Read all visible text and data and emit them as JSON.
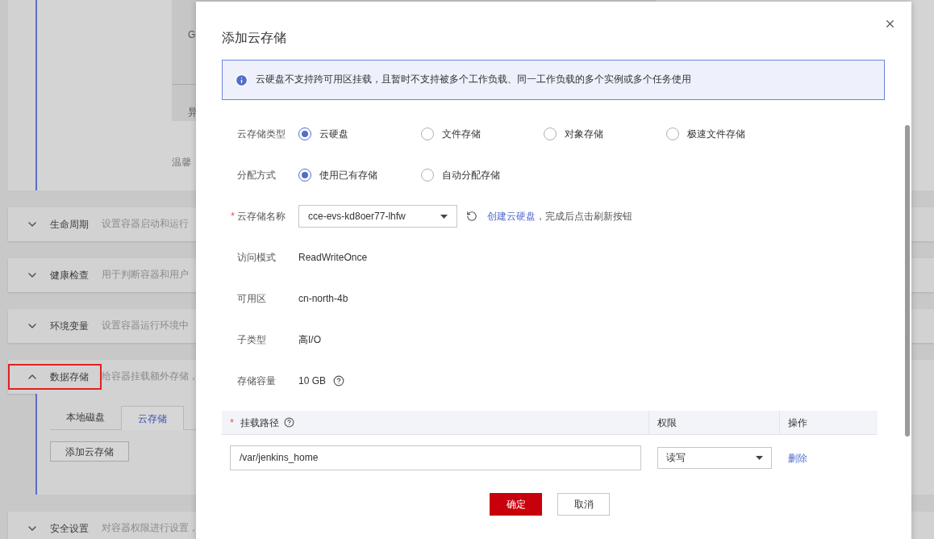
{
  "background": {
    "table_fragments": [
      "G",
      "异"
    ],
    "note": "温馨",
    "sections": [
      {
        "title": "生命周期",
        "description": "设置容器启动和运行",
        "expanded": false,
        "highlighted": false
      },
      {
        "title": "健康检查",
        "description": "用于判断容器和用户",
        "expanded": false,
        "highlighted": false
      },
      {
        "title": "环境变量",
        "description": "设置容器运行环境中",
        "expanded": false,
        "highlighted": false
      },
      {
        "title": "数据存储",
        "description": "给容器挂载额外存储，",
        "expanded": true,
        "highlighted": true,
        "tabs": [
          {
            "label": "本地磁盘",
            "selected": false
          },
          {
            "label": "云存储",
            "selected": true
          }
        ],
        "add_button": "添加云存储"
      },
      {
        "title": "安全设置",
        "description": "对容器权限进行设置，",
        "expanded": false,
        "highlighted": false
      }
    ]
  },
  "dialog": {
    "title": "添加云存储",
    "required_mark": "*",
    "notice": "云硬盘不支持跨可用区挂载，且暂时不支持被多个工作负载、同一工作负载的多个实例或多个任务使用",
    "fields": [
      {
        "kind": "radio",
        "label": "云存储类型",
        "required": false,
        "options": [
          {
            "label": "云硬盘",
            "selected": true
          },
          {
            "label": "文件存储",
            "selected": false
          },
          {
            "label": "对象存储",
            "selected": false
          },
          {
            "label": "极速文件存储",
            "selected": false
          }
        ]
      },
      {
        "kind": "radio",
        "label": "分配方式",
        "required": false,
        "options": [
          {
            "label": "使用已有存储",
            "selected": true
          },
          {
            "label": "自动分配存储",
            "selected": false
          }
        ]
      },
      {
        "kind": "select",
        "label": "云存储名称",
        "required": true,
        "value": "cce-evs-kd8oer77-lhfw",
        "link": "创建云硬盘",
        "hint": "，完成后点击刷新按钮"
      },
      {
        "kind": "text",
        "label": "访问模式",
        "required": false,
        "value": "ReadWriteOnce",
        "help": false
      },
      {
        "kind": "text",
        "label": "可用区",
        "required": false,
        "value": "cn-north-4b",
        "help": false
      },
      {
        "kind": "text",
        "label": "子类型",
        "required": false,
        "value": "高I/O",
        "help": false
      },
      {
        "kind": "text",
        "label": "存储容量",
        "required": false,
        "value": "10 GB",
        "help": true
      }
    ],
    "mount_table": {
      "columns": [
        {
          "label": "挂载路径",
          "required": true,
          "help": true
        },
        {
          "label": "权限",
          "required": false,
          "help": false
        },
        {
          "label": "操作",
          "required": false,
          "help": false
        }
      ],
      "rows": [
        {
          "path": "/var/jenkins_home",
          "permission": "读写",
          "action": "删除"
        }
      ]
    },
    "buttons": [
      {
        "label": "确定",
        "kind": "primary"
      },
      {
        "label": "取消",
        "kind": "default"
      }
    ]
  }
}
